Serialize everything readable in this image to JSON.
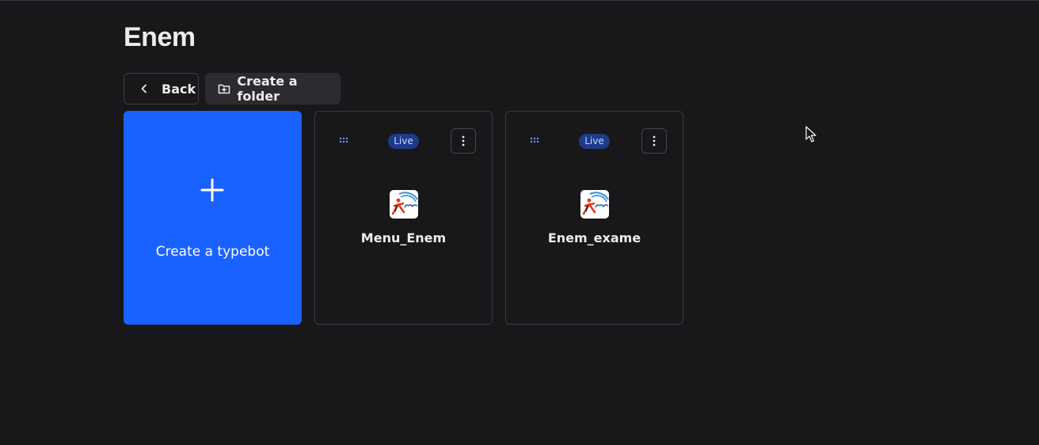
{
  "page": {
    "title": "Enem"
  },
  "toolbar": {
    "back_label": "Back",
    "back_icon": "chevron-left-icon",
    "create_folder_label": "Create a folder",
    "create_folder_icon": "folder-plus-icon"
  },
  "create_card": {
    "label": "Create a typebot",
    "icon": "plus-icon",
    "color": "#1a62ff"
  },
  "typebots": [
    {
      "name": "Menu_Enem",
      "status": "Live",
      "icon": "enem-logo-icon"
    },
    {
      "name": "Enem_exame",
      "status": "Live",
      "icon": "enem-logo-icon"
    }
  ],
  "colors": {
    "background": "#18181b",
    "accent": "#1a62ff",
    "live_badge": "#1e3a8a"
  }
}
